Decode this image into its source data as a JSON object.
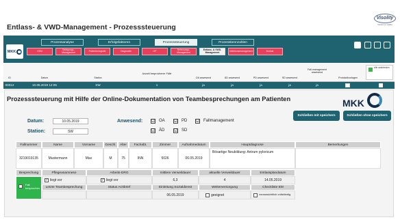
{
  "slide_title": "Entlass- & VWD-Management - Prozesssteuerung",
  "brand": {
    "name": "Visolity",
    "tagline": "Visions to reality"
  },
  "toolbar": {
    "logo_text": "MKK",
    "tabs": [
      {
        "label": "Prozessanalyse",
        "active": false
      },
      {
        "label": "Erfolgsfaktoren",
        "active": false
      },
      {
        "label": "Prozesssteuerung",
        "active": true
      },
      {
        "label": "Prozesskennzahlen",
        "active": false
      }
    ],
    "subtabs": [
      {
        "label": "OSM",
        "active": false
      },
      {
        "label": "Belegungs- Management",
        "active": false
      },
      {
        "label": "Patientenlogistik",
        "active": false
      },
      {
        "label": "Diagnostik",
        "active": false
      },
      {
        "label": "OP",
        "active": false
      },
      {
        "label": "Betreuungs- Management",
        "active": false
      },
      {
        "label": "Entlass- & VWD- Management",
        "active": true
      },
      {
        "label": "Infektionsmanagement",
        "active": false
      },
      {
        "label": "Bonbat",
        "active": false
      }
    ],
    "icons": [
      "save-icon",
      "home-icon",
      "window-icon",
      "back-icon"
    ]
  },
  "table_header": {
    "columns": [
      "ID",
      "Datum",
      "Station",
      "Anzahl besprochener Fälle",
      "OA anwesend",
      "ÄD anwesend",
      "PD anwesend",
      "SD anwesend",
      "Fall-management anwesend",
      "Protokollvorlagen",
      "ausdrucken"
    ],
    "legend": "Alle ausblenden"
  },
  "data_row": [
    "00012",
    "10.05.2019 12:05",
    "SW",
    "1",
    "ja",
    "ja",
    "ja",
    "ja",
    "ja",
    "",
    ""
  ],
  "form": {
    "title": "Prozesssteuerung mit Hilfe der Online-Dokumentation von Teambesprechungen am Patienten",
    "logo": "MKK",
    "datum_label": "Datum:",
    "datum_value": "10.05.2019",
    "station_label": "Station:",
    "station_value": "SW",
    "anwesend_label": "Anwesend:",
    "checks": [
      {
        "label": "OA",
        "checked": true
      },
      {
        "label": "PD",
        "checked": true
      },
      {
        "label": "Fallmanagement",
        "checked": true
      },
      {
        "label": "ÄD",
        "checked": true
      },
      {
        "label": "SD",
        "checked": true
      }
    ],
    "btn_save_close": "Schließen mit speichern",
    "btn_close_nosave": "Schließen ohne speichern",
    "patient_headers": [
      "Fallnummer",
      "Name",
      "Vorname",
      "Geschl.",
      "Alter",
      "Fachabt.",
      "Zimmer",
      "Aufnahmedatum",
      "Hauptdiagnose",
      "Bemerkungen"
    ],
    "patient_row": [
      "3219019135",
      "Mustermann",
      "Max",
      "M",
      "75",
      "INN",
      "5026",
      "06.05.2019",
      "Bösartige Neubildung: Antrum pyloricum",
      ""
    ],
    "besprechung_headers": [
      "Besprechung",
      "Pflegeanamnese",
      "Arbeits-DRG",
      "mittlere Verweildauer",
      "aktuelle Verweildauer",
      "Entlassplandatum"
    ],
    "besprechung_row": {
      "green": "Fall besprochen",
      "pflege": "liegt vor",
      "drg": "liegt vor",
      "mvd": "6,3",
      "avd": "4",
      "plan": "14.05.2019"
    },
    "bottom_headers": [
      "Letzte Teambesprechung",
      "Status Arztbrief",
      "Einleitung Sozialdienst",
      "Weiterversorgung",
      "Checkliste EM"
    ],
    "bottom_row": {
      "einleitung": "06.05.2019",
      "weiter": "geeignet",
      "checkliste": "voraussichtlich vollständig"
    }
  },
  "colors": {
    "teal": "#1f6270",
    "pink": "#e7405a",
    "green": "#2db44a"
  }
}
